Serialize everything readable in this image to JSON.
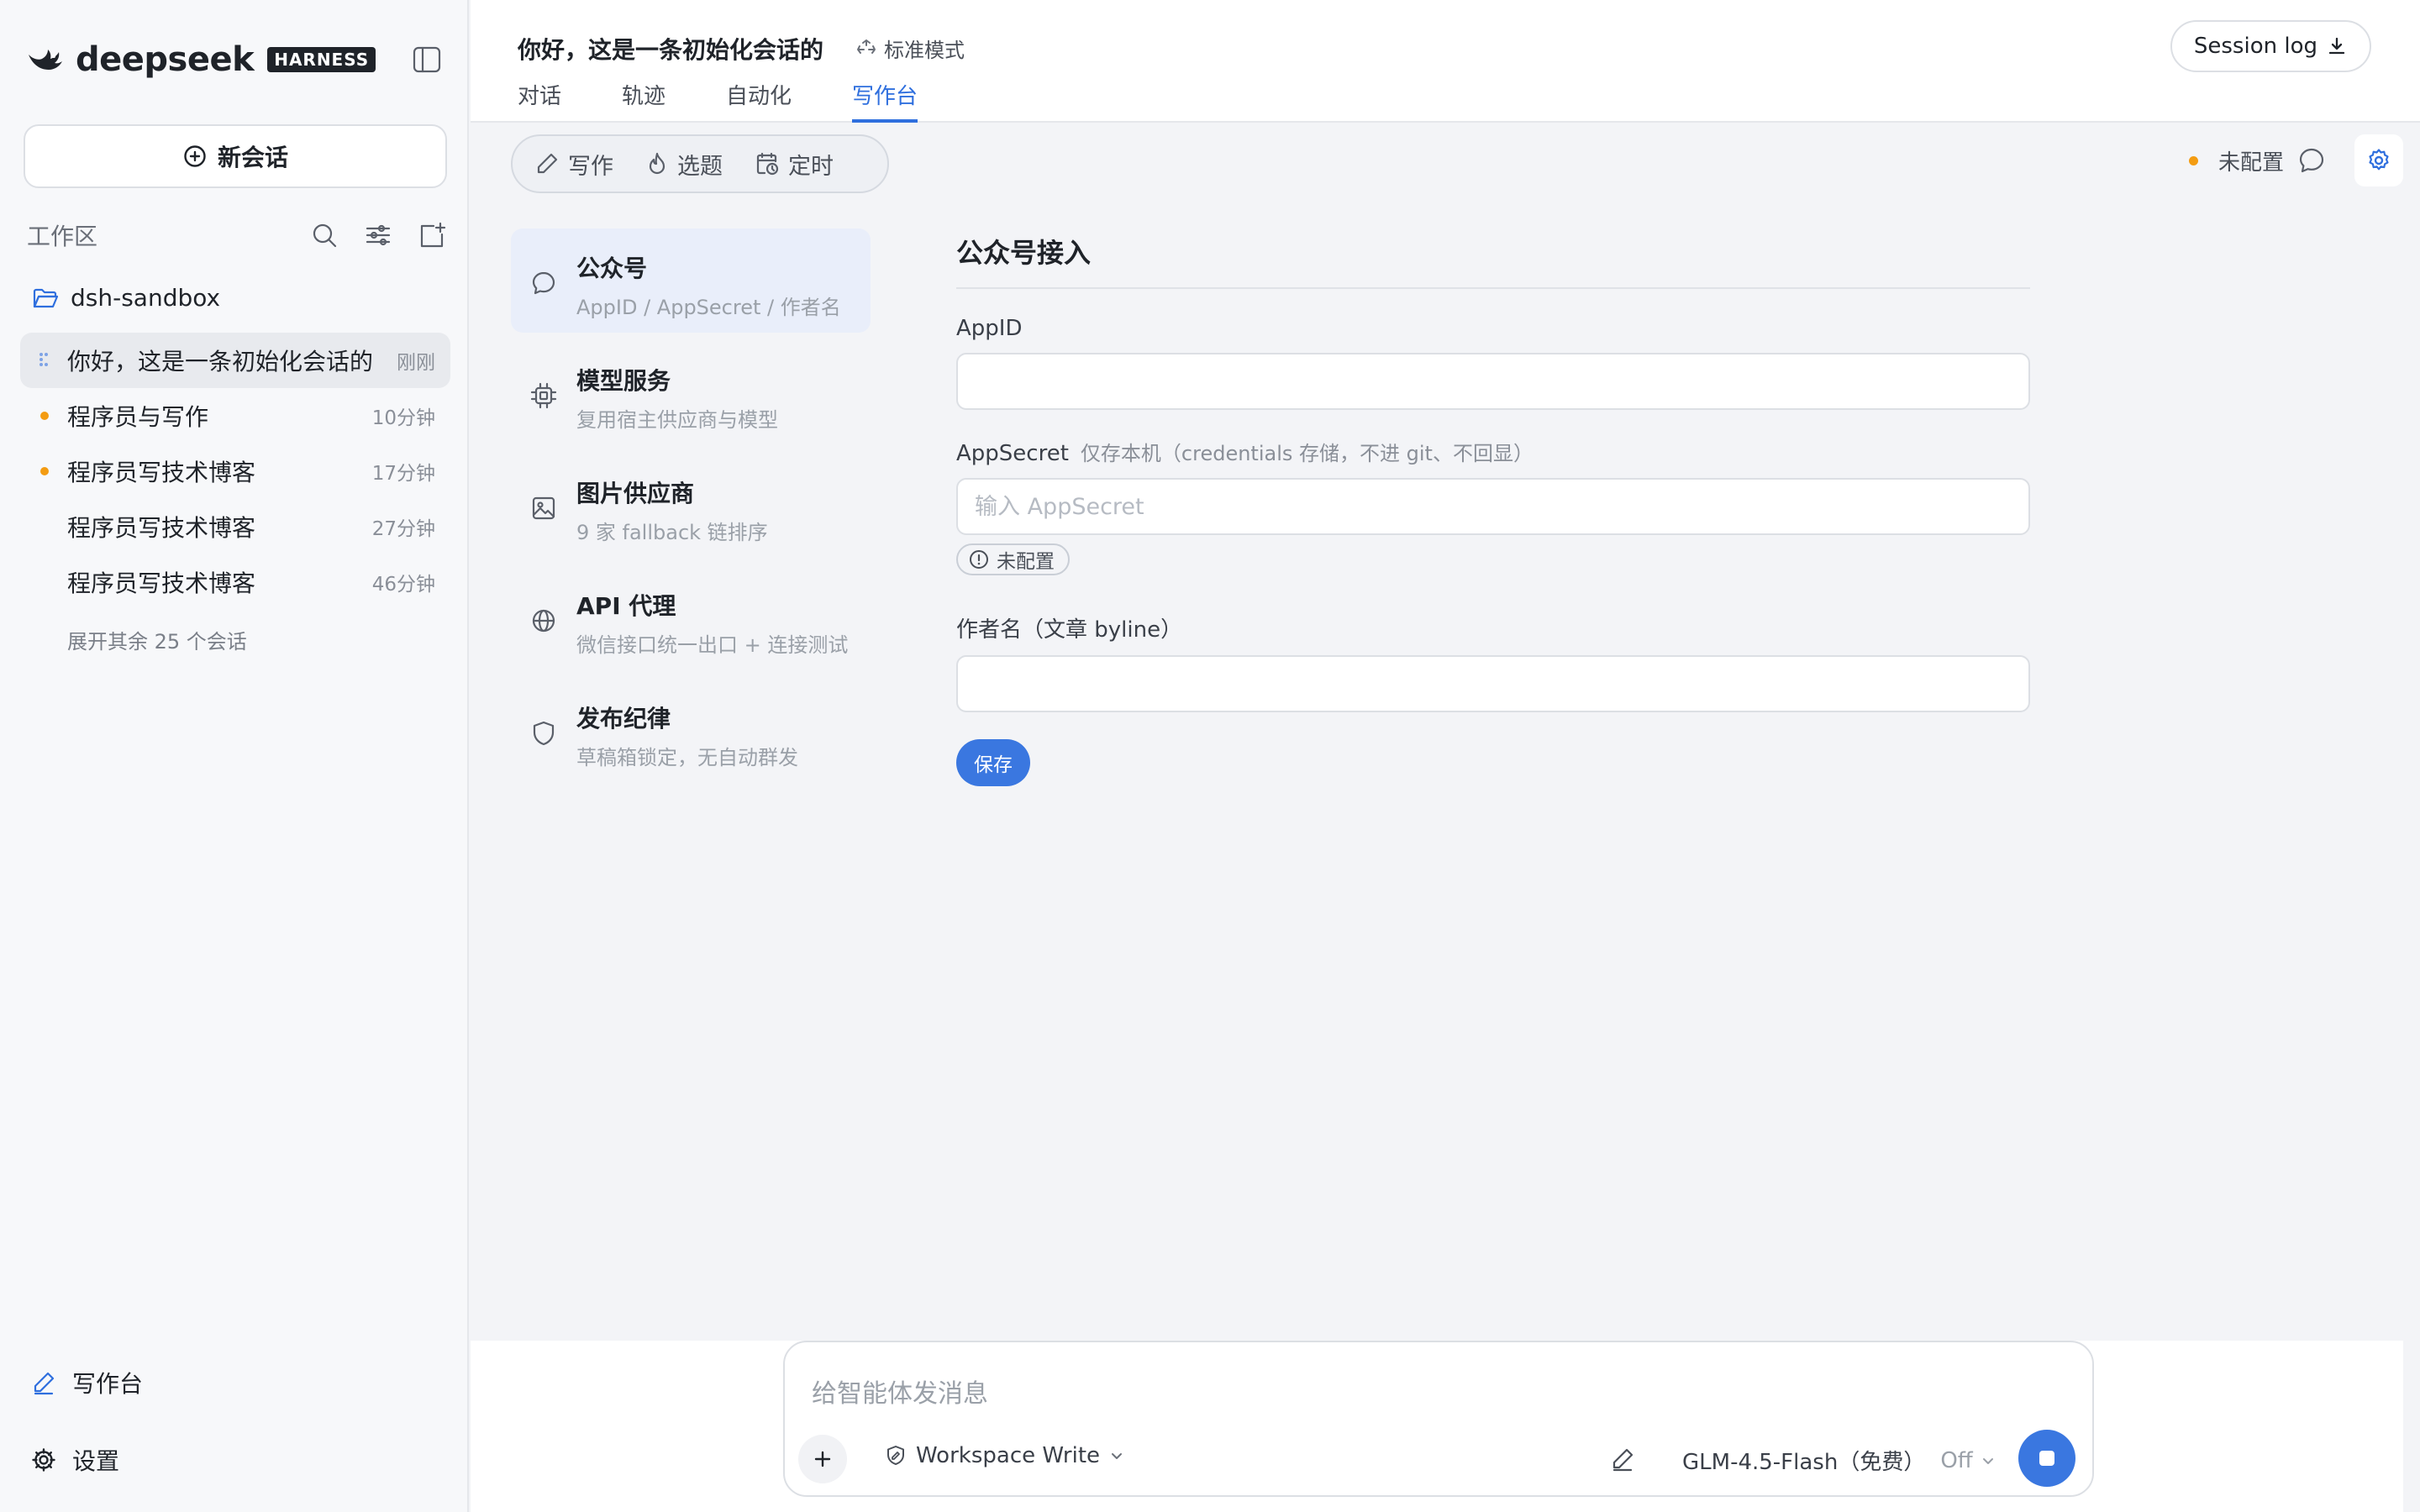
{
  "brand": {
    "name": "deepseek",
    "badge": "HARNESS"
  },
  "sidebar": {
    "new_chat_label": "新会话",
    "workspace_label": "工作区",
    "folder_name": "dsh-sandbox",
    "sessions": [
      {
        "title": "你好，这是一条初始化会话的",
        "time": "刚刚",
        "state": "active"
      },
      {
        "title": "程序员与写作",
        "time": "10分钟",
        "state": "unread"
      },
      {
        "title": "程序员写技术博客",
        "time": "17分钟",
        "state": "unread"
      },
      {
        "title": "程序员写技术博客",
        "time": "27分钟",
        "state": "read"
      },
      {
        "title": "程序员写技术博客",
        "time": "46分钟",
        "state": "read"
      }
    ],
    "expand_more": "展开其余 25 个会话",
    "bottom_items": [
      {
        "label": "写作台",
        "icon": "pen-icon"
      },
      {
        "label": "设置",
        "icon": "gear-icon"
      }
    ]
  },
  "header": {
    "title": "你好，这是一条初始化会话的",
    "mode": "标准模式",
    "tabs": [
      "对话",
      "轨迹",
      "自动化",
      "写作台"
    ],
    "active_tab": "写作台",
    "session_log_label": "Session log"
  },
  "toolbar": {
    "segments": [
      {
        "label": "写作",
        "icon": "pen-icon"
      },
      {
        "label": "选题",
        "icon": "flame-icon"
      },
      {
        "label": "定时",
        "icon": "calendar-clock-icon"
      }
    ],
    "status_text": "未配置"
  },
  "settings_nav": [
    {
      "title": "公众号",
      "sub": "AppID / AppSecret / 作者名",
      "icon": "message-circle-icon",
      "active": true
    },
    {
      "title": "模型服务",
      "sub": "复用宿主供应商与模型",
      "icon": "cpu-chip-icon",
      "active": false
    },
    {
      "title": "图片供应商",
      "sub": "9 家 fallback 链排序",
      "icon": "image-icon",
      "active": false
    },
    {
      "title": "API 代理",
      "sub": "微信接口统一出口 + 连接测试",
      "icon": "globe-icon",
      "active": false
    },
    {
      "title": "发布纪律",
      "sub": "草稿箱锁定，无自动群发",
      "icon": "shield-icon",
      "active": false
    }
  ],
  "form": {
    "title": "公众号接入",
    "appid_label": "AppID",
    "appid_value": "",
    "appsecret_label": "AppSecret",
    "appsecret_hint": "仅存本机（credentials 存储，不进 git、不回显）",
    "appsecret_placeholder": "输入 AppSecret",
    "appsecret_status": "未配置",
    "author_label": "作者名（文章 byline）",
    "author_value": "",
    "save_label": "保存"
  },
  "composer": {
    "placeholder": "给智能体发消息",
    "permission": "Workspace Write",
    "model": "GLM-4.5-Flash（免费）",
    "thinking": "Off"
  },
  "colors": {
    "accent": "#3a77e0",
    "warning": "#f39c12"
  }
}
